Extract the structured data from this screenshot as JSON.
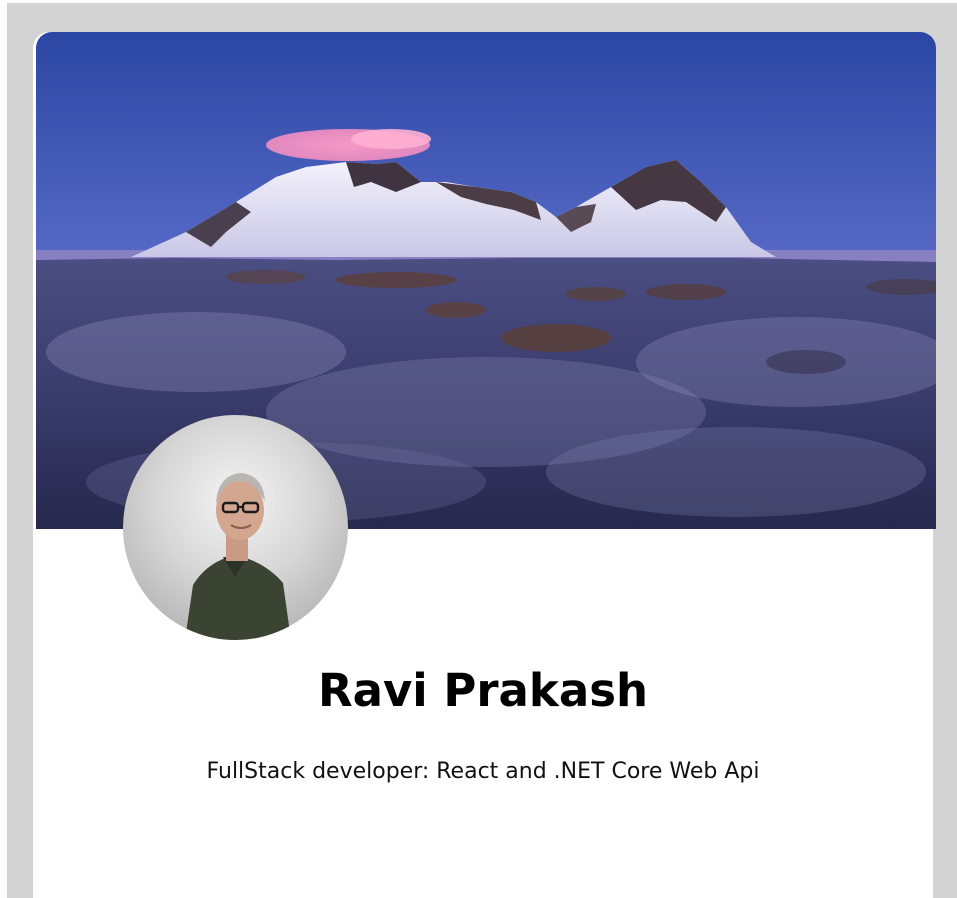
{
  "profile": {
    "name": "Ravi Prakash",
    "bio": "FullStack developer: React and .NET Core Web Api"
  },
  "cover": {
    "description_icon": "mountain-landscape-image"
  },
  "avatar": {
    "icon": "person-photo"
  },
  "colors": {
    "outer_background": "#d3d3d3",
    "card_background": "#ffffff",
    "sky_top": "#2f4ea6",
    "sky_bottom": "#d58fb0"
  }
}
